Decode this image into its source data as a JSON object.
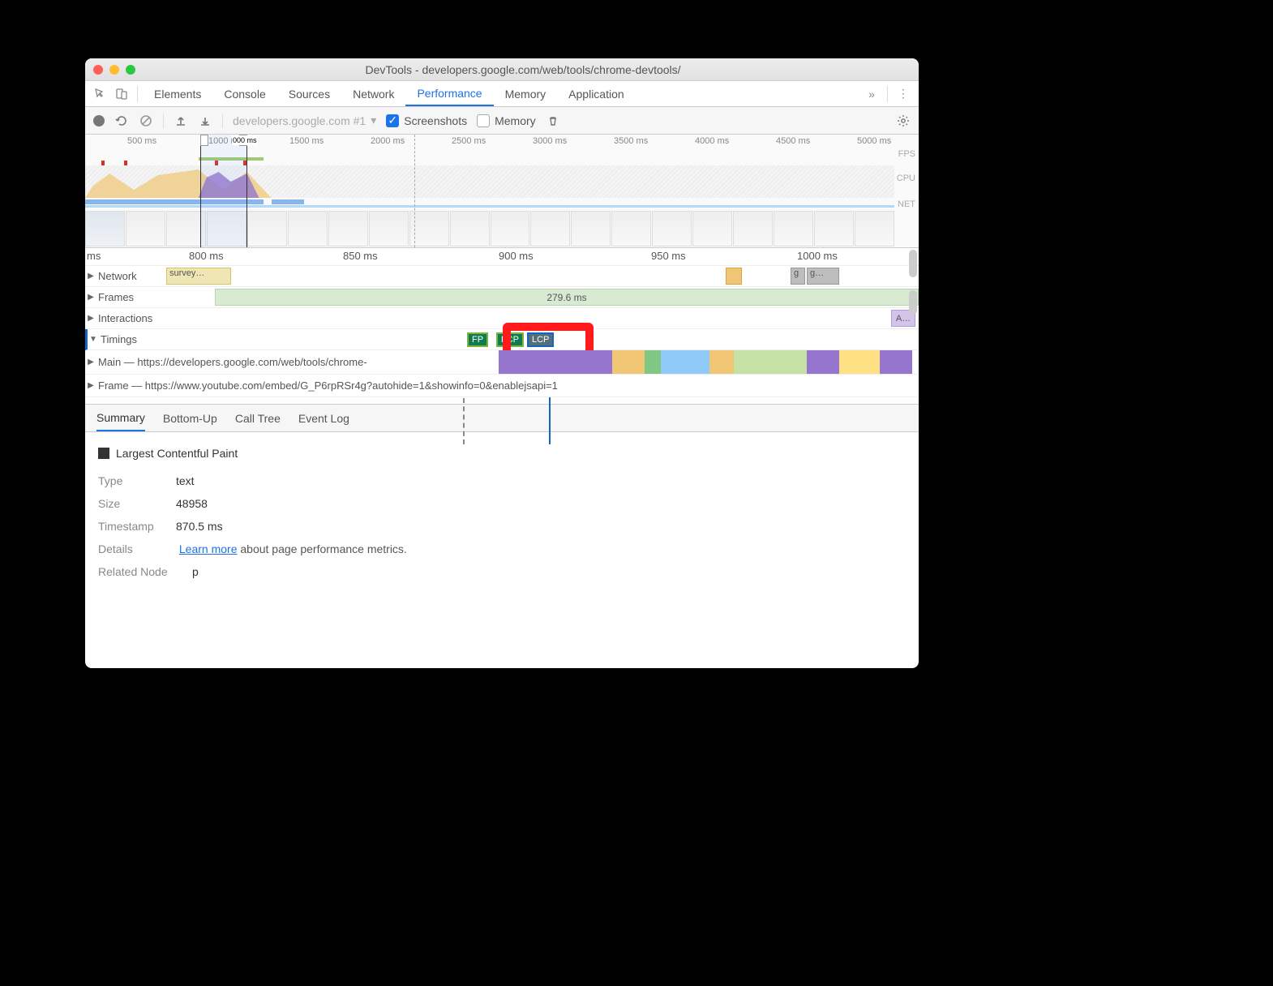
{
  "window": {
    "title": "DevTools - developers.google.com/web/tools/chrome-devtools/"
  },
  "tabs": {
    "items": [
      "Elements",
      "Console",
      "Sources",
      "Network",
      "Performance",
      "Memory",
      "Application"
    ],
    "active": "Performance"
  },
  "toolbar": {
    "recording_dropdown": "developers.google.com #1",
    "screenshots_label": "Screenshots",
    "memory_label": "Memory"
  },
  "overview": {
    "ticks": [
      "500 ms",
      "1000 ms",
      "1500 ms",
      "2000 ms",
      "2500 ms",
      "3000 ms",
      "3500 ms",
      "4000 ms",
      "4500 ms",
      "5000 ms"
    ],
    "lanes": {
      "fps": "FPS",
      "cpu": "CPU",
      "net": "NET"
    },
    "selection_label": "000 ms"
  },
  "detail": {
    "ruler": [
      "ms",
      "800 ms",
      "850 ms",
      "900 ms",
      "950 ms",
      "1000 ms"
    ],
    "rows": {
      "network": {
        "label": "Network",
        "task": "survey…"
      },
      "frames": {
        "label": "Frames",
        "value": "279.6 ms",
        "tail1": "g",
        "tail2": "g…"
      },
      "interactions": {
        "label": "Interactions",
        "anim": "A…"
      },
      "timings": {
        "label": "Timings",
        "fp": "FP",
        "fcp": "FCP",
        "lcp": "LCP"
      },
      "main": {
        "label": "Main — https://developers.google.com/web/tools/chrome-"
      },
      "frame": {
        "label": "Frame — https://www.youtube.com/embed/G_P6rpRSr4g?autohide=1&showinfo=0&enablejsapi=1"
      }
    }
  },
  "bottom": {
    "tabs": [
      "Summary",
      "Bottom-Up",
      "Call Tree",
      "Event Log"
    ],
    "active": "Summary",
    "title": "Largest Contentful Paint",
    "type_k": "Type",
    "type_v": "text",
    "size_k": "Size",
    "size_v": "48958",
    "ts_k": "Timestamp",
    "ts_v": "870.5 ms",
    "details_k": "Details",
    "learn": "Learn more",
    "details_tail": " about page performance metrics.",
    "node_k": "Related Node",
    "node_v": "p"
  }
}
